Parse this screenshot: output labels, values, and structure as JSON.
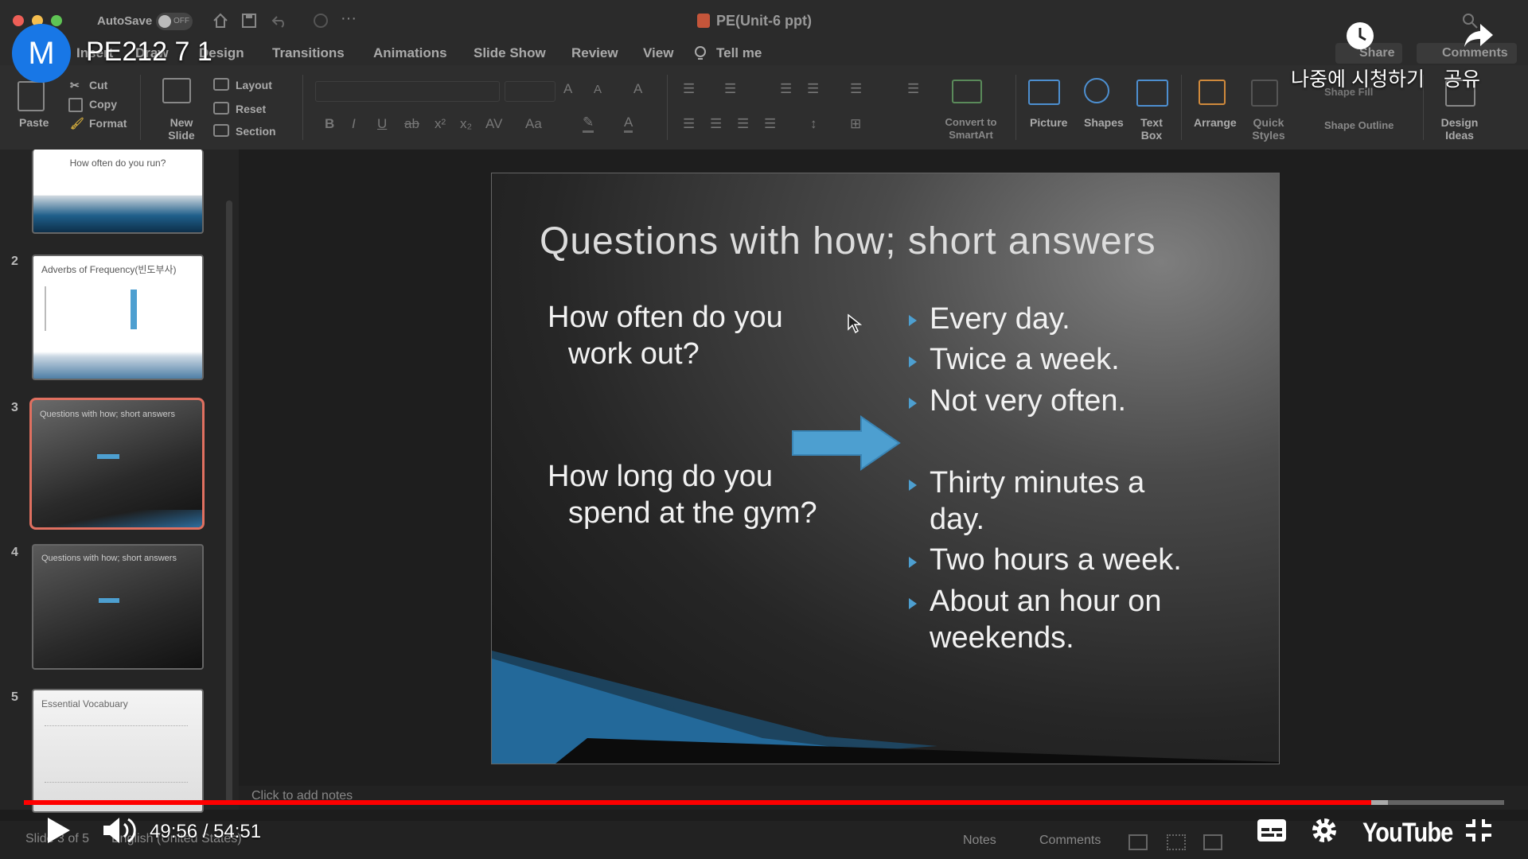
{
  "app": {
    "autosave_label": "AutoSave",
    "autosave_state": "OFF",
    "document_title": "PE(Unit-6 ppt)"
  },
  "tabs": [
    "Insert",
    "Draw",
    "Design",
    "Transitions",
    "Animations",
    "Slide Show",
    "Review",
    "View",
    "Tell me"
  ],
  "ribbon": {
    "paste": "Paste",
    "cut": "Cut",
    "copy": "Copy",
    "format": "Format",
    "new_slide": "New Slide",
    "layout": "Layout",
    "reset": "Reset",
    "section": "Section",
    "convert_smartart": "Convert to SmartArt",
    "picture": "Picture",
    "shapes": "Shapes",
    "text_box": "Text Box",
    "arrange": "Arrange",
    "quick_styles": "Quick Styles",
    "shape_fill": "Shape Fill",
    "shape_outline": "Shape Outline",
    "design_ideas": "Design Ideas",
    "share": "Share",
    "comments": "Comments"
  },
  "thumbnails": [
    {
      "num": "",
      "title": "How often do you run?"
    },
    {
      "num": "2",
      "title": "Adverbs of Frequency(빈도부사)"
    },
    {
      "num": "3",
      "title": "Questions with how; short answers"
    },
    {
      "num": "4",
      "title": "Questions with how; short answers"
    },
    {
      "num": "5",
      "title": "Essential Vocabuary"
    }
  ],
  "slide": {
    "title": "Questions with how; short answers",
    "question1_line1": "How often do you",
    "question1_line2": "work out?",
    "question2_line1": "How long do you",
    "question2_line2": "spend at the gym?",
    "answers": [
      "Every day.",
      "Twice a week.",
      "Not very often.",
      "Thirty minutes a",
      "day.",
      "Two hours a week.",
      "About an hour on",
      "weekends."
    ]
  },
  "notes_placeholder": "Click to add notes",
  "status": {
    "slide_info": "Slide 3 of 5",
    "language": "English (United States)",
    "notes": "Notes",
    "comments": "Comments"
  },
  "youtube": {
    "channel_initial": "M",
    "video_title": "PE212 7 1",
    "watch_later": "나중에 시청하기",
    "share": "공유",
    "current_time": "49:56",
    "duration": "54:51",
    "time_display": "49:56 / 54:51",
    "played_fraction": 0.9104,
    "buffered_fraction": 0.9215,
    "logo": "YouTube"
  },
  "colors": {
    "accent_blue": "#4d9fd0",
    "progress_red": "#ff0000",
    "avatar_blue": "#1877e6",
    "selected_thumb_border": "#e07060"
  }
}
